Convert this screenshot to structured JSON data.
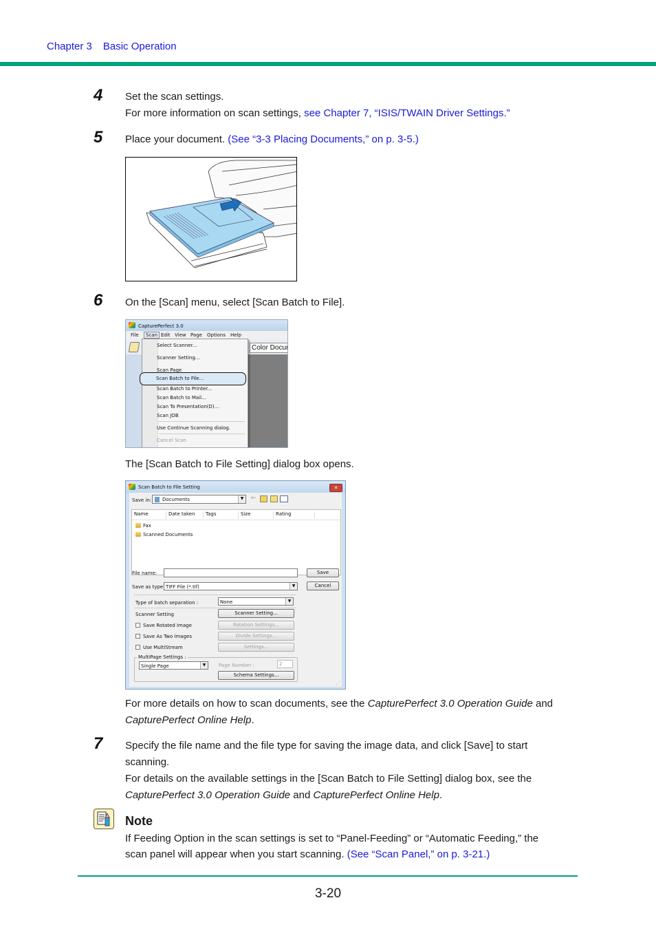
{
  "header": {
    "chapter": "Chapter 3",
    "section": "Basic Operation"
  },
  "colors": {
    "accent_rule": "#00a27a",
    "link": "#1a1ad8"
  },
  "steps": [
    {
      "number": "4",
      "lines": [
        "Set the scan settings."
      ],
      "more_prefix": "For more information on scan settings, ",
      "more_link": "see Chapter 7, “ISIS/TWAIN Driver Settings.”"
    },
    {
      "number": "5",
      "text": "Place your document. ",
      "link": "(See “3-3 Placing Documents,” on p. 3-5.)",
      "figure": "document-feeding-illustration"
    },
    {
      "number": "6",
      "text": "On the [Scan] menu, select [Scan Batch to File].",
      "after_menu_text": "The [Scan Batch to File Setting] dialog box opens.",
      "details_prefix": "For more details on how to scan documents, see the ",
      "details_guide": "CapturePerfect 3.0 Operation Guide",
      "details_and": " and",
      "details_help": "CapturePerfect Online Help",
      "details_end": "."
    },
    {
      "number": "7",
      "line1": "Specify the file name and the file type for saving the image data, and click [Save] to start",
      "line2": "scanning.",
      "line3": "For details on the available settings in the [Scan Batch to File Setting] dialog box, see the",
      "line4_guide": "CapturePerfect 3.0 Operation Guide",
      "line4_and": " and ",
      "line4_help": "CapturePerfect Online Help",
      "line4_end": "."
    }
  ],
  "menu_screenshot": {
    "app_title": "CapturePerfect 3.0",
    "menubar": [
      "File",
      "Scan",
      "Edit",
      "View",
      "Page",
      "Options",
      "Help"
    ],
    "active_menu": "Scan",
    "toolbar_combo": "Color Docum",
    "items": [
      {
        "label": "Select Scanner...",
        "state": "normal"
      },
      {
        "label": "Scanner Setting...",
        "state": "normal"
      },
      {
        "label": "Scan Page",
        "state": "normal"
      },
      {
        "label": "Scan Batch to File...",
        "state": "highlighted"
      },
      {
        "label": "Scan Batch to Printer...",
        "state": "normal"
      },
      {
        "label": "Scan Batch to Mail...",
        "state": "normal"
      },
      {
        "label": "Scan To Presentation(D)...",
        "state": "normal"
      },
      {
        "label": "Scan JOB",
        "state": "normal"
      },
      {
        "label": "Use Continue Scanning dialog.",
        "state": "normal"
      },
      {
        "label": "Cancel Scan",
        "state": "disabled"
      }
    ]
  },
  "dialog": {
    "title": "Scan Batch to File Setting",
    "close": "✕",
    "save_in_label": "Save in:",
    "save_in_value": "Documents",
    "columns": [
      "Name",
      "Date taken",
      "Tags",
      "Size",
      "Rating"
    ],
    "files": [
      "Fax",
      "Scanned Documents"
    ],
    "file_name_label": "File name:",
    "file_name_value": "",
    "save_as_type_label": "Save as type:",
    "save_as_type_value": "TIFF File (*.tif)",
    "save_button": "Save",
    "cancel_button": "Cancel",
    "batch_sep_label": "Type of batch separation :",
    "batch_sep_value": "None",
    "scanner_setting_label": "Scanner Setting",
    "scanner_setting_button": "Scanner Setting...",
    "options": [
      {
        "label": "Save Rotated Image",
        "checked": false,
        "button": "Rotation Settings..."
      },
      {
        "label": "Save As Two Images",
        "checked": false,
        "button": "Divide Settings..."
      },
      {
        "label": "Use MultiStream",
        "checked": false,
        "button": "Settings..."
      }
    ],
    "multipage_group": "MultiPage Settings :",
    "multipage_value": "Single Page",
    "page_number_label": "Page Number :",
    "page_number_value": "2",
    "schema_button": "Schema Settings..."
  },
  "note": {
    "title": "Note",
    "text": "If Feeding Option in the scan settings is set to “Panel-Feeding” or “Automatic Feeding,” the",
    "text2": "scan panel will appear when you start scanning. ",
    "link": "(See “Scan Panel,” on p. 3-21.)"
  },
  "footer": {
    "page_number": "3-20"
  }
}
